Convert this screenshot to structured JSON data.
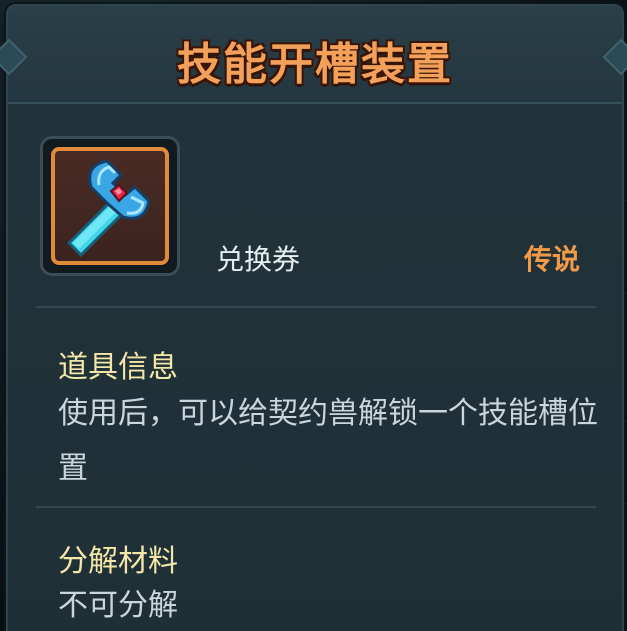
{
  "dialog": {
    "title": "技能开槽装置"
  },
  "item": {
    "icon": "wrench-icon",
    "type_label": "兑换券",
    "rarity_label": "传说",
    "rarity_color": "#f29a48",
    "frame_color": "#e08a3a"
  },
  "sections": {
    "info": {
      "title": "道具信息",
      "body": "使用后，可以给契约兽解锁一个技能槽位置"
    },
    "decompose": {
      "title": "分解材料",
      "body": "不可分解"
    }
  },
  "colors": {
    "title": "#f3a05a",
    "section_title": "#f2e7a8",
    "body_text": "#cbd5dc",
    "panel_bg": "#22333b"
  }
}
